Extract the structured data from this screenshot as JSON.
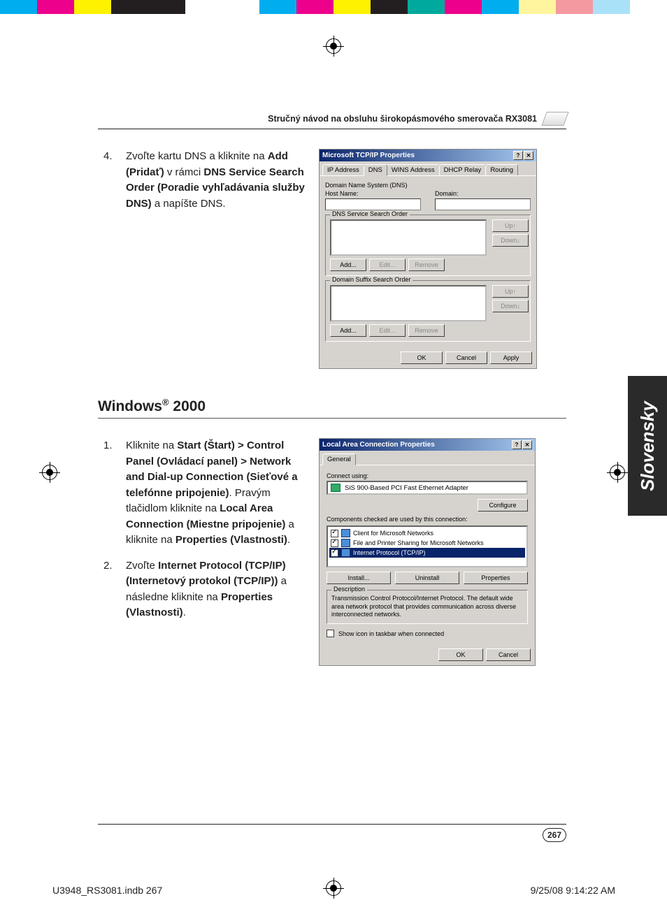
{
  "header": {
    "title": "Stručný návod na obsluhu širokopásmového smerovača RX3081"
  },
  "sideTab": "Slovensky",
  "pageNumber": "267",
  "footer": {
    "file": "U3948_RS3081.indb   267",
    "timestamp": "9/25/08   9:14:22 AM"
  },
  "step4": {
    "number": "4.",
    "a": "Zvoľte kartu DNS a kliknite na ",
    "b1": "Add (Pridať)",
    "c": " v rámci ",
    "b2": "DNS Service Search Order (Poradie vyhľadávania služby DNS)",
    "d": "  a napíšte DNS."
  },
  "dialog1": {
    "title": "Microsoft TCP/IP Properties",
    "tabs": [
      "IP Address",
      "DNS",
      "WINS Address",
      "DHCP Relay",
      "Routing"
    ],
    "dnsSystem": "Domain Name System (DNS)",
    "hostLabel": "Host Name:",
    "domainLabel": "Domain:",
    "searchOrder": "DNS Service Search Order",
    "suffixOrder": "Domain Suffix Search Order",
    "buttons": {
      "add": "Add...",
      "edit": "Edit...",
      "remove": "Remove",
      "up": "Up↑",
      "down": "Down↓",
      "ok": "OK",
      "cancel": "Cancel",
      "apply": "Apply"
    }
  },
  "sectionHeading": "Windows",
  "sectionHeadingSup": "®",
  "sectionHeadingRest": " 2000",
  "step1": {
    "number": "1.",
    "a": "Kliknite na ",
    "b1": "Start (Štart) > Control Panel (Ovládací panel) > Network and Dial-up Connection (Sieťové a telefónne pripojenie)",
    "c": ". Pravým tlačidlom kliknite na ",
    "b2": "Local Area Connection (Miestne pripojenie)",
    "d": " a kliknite na ",
    "b3": "Properties (Vlastnosti)",
    "e": "."
  },
  "step2": {
    "number": "2.",
    "a": "Zvoľte ",
    "b1": "Internet Protocol (TCP/IP) (Internetový protokol (TCP/IP))",
    "c": " a následne kliknite na ",
    "b2": "Properties (Vlastnosti)",
    "d": "."
  },
  "dialog2": {
    "title": "Local Area Connection Properties",
    "tab": "General",
    "connectUsing": "Connect using:",
    "adapter": "SiS 900-Based PCI Fast Ethernet Adapter",
    "configure": "Configure",
    "componentsLabel": "Components checked are used by this connection:",
    "components": {
      "c1": "Client for Microsoft Networks",
      "c2": "File and Printer Sharing for Microsoft Networks",
      "c3": "Internet Protocol (TCP/IP)"
    },
    "buttons": {
      "install": "Install...",
      "uninstall": "Uninstall",
      "properties": "Properties",
      "ok": "OK",
      "cancel": "Cancel"
    },
    "descLabel": "Description",
    "descText": "Transmission Control Protocol/Internet Protocol. The default wide area network protocol that provides communication across diverse interconnected networks.",
    "showIcon": "Show icon in taskbar when connected"
  },
  "colors": [
    "#00adee",
    "#ed008c",
    "#fff200",
    "#231f20",
    "#231f20",
    "#ffffff",
    "#ffffff",
    "#00adee",
    "#ed008c",
    "#fff200",
    "#231f20",
    "#00a99d",
    "#ec008c",
    "#00adee",
    "#fff59e",
    "#f4999f",
    "#a9e1f9",
    "#ffffff"
  ]
}
